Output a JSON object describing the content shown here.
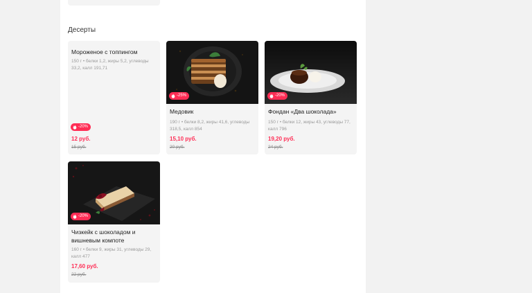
{
  "section": {
    "title": "Десерты"
  },
  "items": [
    {
      "name": "Мороженое с топпингом",
      "desc": "150 г • белки 1,2, жиры 5,2, углеводы 33,2, калл 191,71",
      "badge": "-20%",
      "price": "12 руб.",
      "old_price": "15 руб."
    },
    {
      "name": "Медовик",
      "desc": "190 г • белки 8,2, жиры 41,6, углеводы 318,5, калл 854",
      "badge": "-25%",
      "price": "15,10 руб.",
      "old_price": "20 руб."
    },
    {
      "name": "Фондан «Два шоколада»",
      "desc": "150 г • белки 12, жиры 43, углеводы 77, калл 796",
      "badge": "-20%",
      "price": "19,20 руб.",
      "old_price": "24 руб."
    },
    {
      "name": "Чизкейк с шоколадом и вишневым компоте",
      "desc": "160 г • белки 9, жиры 31, углеводы 29, калл 477",
      "badge": "-20%",
      "price": "17,60 руб.",
      "old_price": "22 руб."
    }
  ],
  "colors": {
    "accent": "#ff2d55",
    "card_bg": "#f4f4f4",
    "page_bg": "#f2f2f2"
  },
  "icons": {
    "badge": "flame-icon"
  }
}
